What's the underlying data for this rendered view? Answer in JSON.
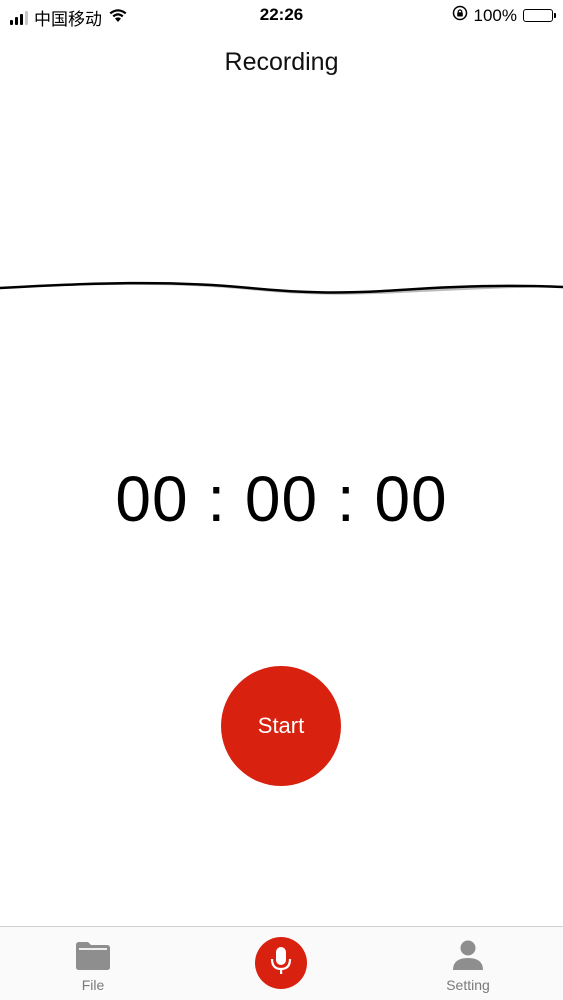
{
  "status_bar": {
    "carrier": "中国移动",
    "time": "22:26",
    "battery_percent": "100%",
    "battery_level": 1.0,
    "icons": [
      "signal-icon",
      "wifi-icon",
      "rotation-lock-icon",
      "battery-icon"
    ]
  },
  "header": {
    "title": "Recording"
  },
  "timer": {
    "display": "00 : 00 : 00"
  },
  "controls": {
    "start_label": "Start"
  },
  "tab_bar": {
    "tabs": [
      {
        "label": "File",
        "icon": "folder-icon",
        "active": false
      },
      {
        "label": "",
        "icon": "microphone-icon",
        "active": true
      },
      {
        "label": "Setting",
        "icon": "person-icon",
        "active": false
      }
    ]
  },
  "colors": {
    "accent": "#d8210f",
    "tab_icon": "#8e8e8e",
    "tab_label": "#7a7a7a",
    "text": "#111111"
  }
}
